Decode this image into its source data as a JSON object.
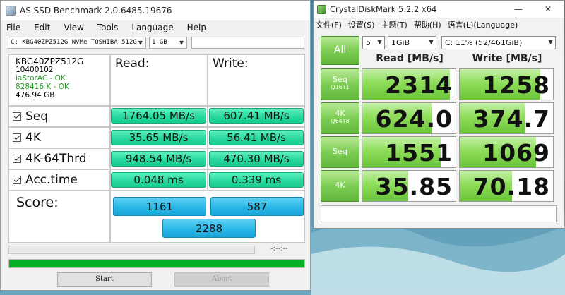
{
  "as_ssd": {
    "title": "AS SSD Benchmark 2.0.6485.19676",
    "menu": [
      "File",
      "Edit",
      "View",
      "Tools",
      "Language",
      "Help"
    ],
    "drive_select": "C: KBG40ZPZ512G NVMe TOSHIBA 512G",
    "size_select": "1 GB",
    "info": {
      "model": "KBG40ZPZ512G",
      "firmware": "10400102",
      "driver": "iaStorAC - OK",
      "alignment": "828416 K - OK",
      "capacity": "476.94 GB"
    },
    "headers": {
      "read": "Read:",
      "write": "Write:"
    },
    "rows": [
      {
        "label": "Seq",
        "read": "1764.05 MB/s",
        "write": "607.41 MB/s"
      },
      {
        "label": "4K",
        "read": "35.65 MB/s",
        "write": "56.41 MB/s"
      },
      {
        "label": "4K-64Thrd",
        "read": "948.54 MB/s",
        "write": "470.30 MB/s"
      },
      {
        "label": "Acc.time",
        "read": "0.048 ms",
        "write": "0.339 ms"
      }
    ],
    "score": {
      "label": "Score:",
      "read": "1161",
      "write": "587",
      "total": "2288"
    },
    "timer": "-:--:--",
    "buttons": {
      "start": "Start",
      "abort": "Abort"
    }
  },
  "cdm": {
    "title": "CrystalDiskMark 5.2.2 x64",
    "menu": [
      "文件(F)",
      "设置(S)",
      "主题(T)",
      "帮助(H)",
      "语言(L)(Language)"
    ],
    "all_label": "All",
    "count": "5",
    "size": "1GiB",
    "drive": "C: 11% (52/461GiB)",
    "headers": {
      "read": "Read [MB/s]",
      "write": "Write [MB/s]"
    },
    "rows": [
      {
        "l1": "Seq",
        "l2": "Q16T1",
        "read": "2314",
        "write": "1258"
      },
      {
        "l1": "4K",
        "l2": "Q64T8",
        "read": "624.0",
        "write": "374.7"
      },
      {
        "l1": "Seq",
        "l2": "",
        "read": "1551",
        "write": "1069"
      },
      {
        "l1": "4K",
        "l2": "",
        "read": "35.85",
        "write": "70.18"
      }
    ],
    "comment": ""
  },
  "colors": {
    "as_value_green": "#29d9a0",
    "as_score_blue": "#26b5e6",
    "cdm_green": "#7dcd55",
    "progress_green": "#06b025"
  }
}
